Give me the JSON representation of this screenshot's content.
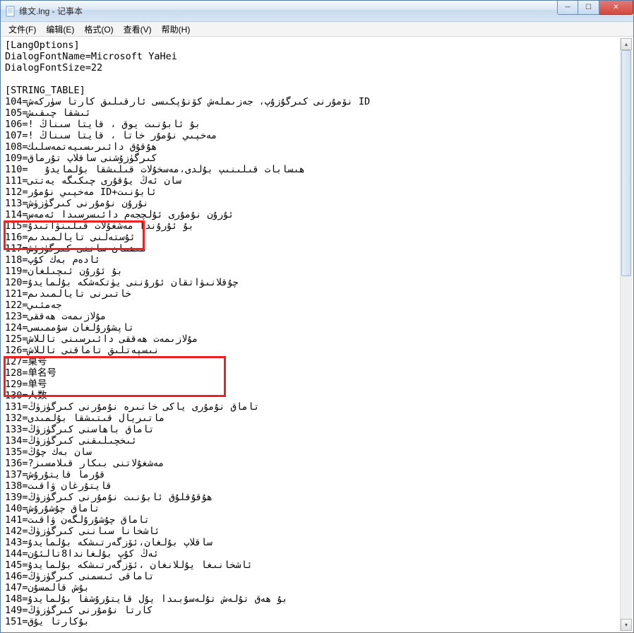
{
  "window": {
    "title": "维文.lng - 记事本"
  },
  "menu": {
    "file": "文件(F)",
    "edit": "编辑(E)",
    "format": "格式(O)",
    "view": "查看(V)",
    "help": "帮助(H)"
  },
  "content": "[LangOptions]\nDialogFontName=Microsoft YaHei\nDialogFontSize=22\n\n[STRING_TABLE]\n104=نۆمۇرنى كىرگۇزۇپ، جەزىملەش كۆنۇپكىسى ئارقىلىق كارتا سۈركەش ID\n105=ئىشقا چىقىش\n106=! بۇ ئابۇنىت يوق ، قايتا سىناڭ\n107=! مەخپىي نۇمۇر خاتا ، قايتا سىناڭ\n108=ھۇقۇق دائىرىسىيەتمەسلىك\n109=كىرگۈزۇشنى ساقلاپ تۇرماق\n110=   ھىسابات قىلىنىپ بۇلدى،مەسخۇلات قىلىشقا بۇلمايدۇ\n111=سان ئەڭ يۇقۇرى چىكىگە يەتتى\n112=مەخپىي نۇمۇر ID+ئابۇنىت\n113=نۇرۇن نۇمۇرنى كىرگۈزۈش\n114=ئۇرۇن نۇمۇرى ئۇلچجەم دائىسرسىدا ئەمەس\n115=بۇ ئۇرۇندا مەشغۇلات قىلىنۋاتىدۇ\n116=ئۇستەلنى تايالمىدىم\n117=مىھمان ساننى كىرگۈزۈش\n118=ئادەم بەك كۇپ\n119=بۇ ئۇرۇن ئىچىلغان\n120=چۇقلانىۋاتقان ئۇرۇننى يۈتكەشكە بۇلمايدۇ\n121=خاتىرنى تايالمىدىم\n122=جەمئىي\n123=مۇلازىمەت ھەققى\n124=تاپشۇرۇلغان سۇممىسى\n125=مۇلازىمەت ھەققى دائىرسىنى تاللاش\n126=نىسپەتلىق تاماقنى تاللاش\n127=桌号\n128=单名号\n129=单号\n130=人数\n131=تاماق نۇمۇرى ياكى خاتىرە نۇمۇرنى كىرگۈزۈڭ\n132=ماتىريال قىتىشقا بۇلمىدى\n133=تاماق باھاسنى كىرگۈزۈڭ\n134=ئىخچىلىقنى كىرگۈزۈڭ\n135=سان بەك چۇڭ\n136=?مەشغۇلاتنى بىكار قىلامسىز\n137=قۇرما قايتۇرۇش\n138=قايتۇرغان ۋاقىت\n139=ھۇقۇقلۇق ئابۇنىت نۇمۇرنى كىرگۈزۈڭ\n140=تاماق چۇشۇرۇش\n141=تاماق چۇشۇرۇلگەن ۋاقىت\n142=ئاشخانا سىاننى كىرگۈزۈڭ\n143=ساقلاپ بۇلغان،ئۆزگەرتىشكە بۇلمايدۇ\n144=ئەڭ كۇپ بۇلغاندا8تالئۇن\n145=ئاشخانىغا يۇللانغان ،ئۆزگەرتىشكە بۇلمايدۇ\n146=تاماقى ئىسمنى كىرگۈزۈڭ\n147=بۇش قالمسۇن\n148=بۇ ھەق تۇلەش تۇلەسۇبىدا يۇل قايتۇرۇشقا بۇلمايدۇ\n149=كارتا نۇمۇرنى كىرگۈزۈڭ\n151=بۇكارتا يۇق",
  "controls": {
    "minimize": "─",
    "maximize": "☐",
    "close": "✕"
  },
  "scroll": {
    "up": "▴",
    "down": "▾"
  }
}
